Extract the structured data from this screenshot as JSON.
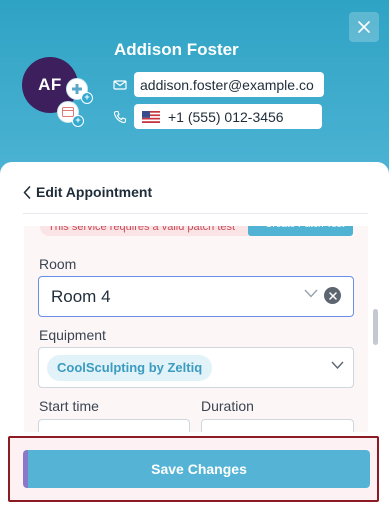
{
  "contact": {
    "initials": "AF",
    "name": "Addison Foster",
    "email": "addison.foster@example.co",
    "phone": "+1 (555) 012-3456"
  },
  "panel": {
    "title": "Edit Appointment",
    "warning_text": "This service requires a valid patch test",
    "patch_button": "+ Create Patch Test",
    "room": {
      "label": "Room",
      "value": "Room 4"
    },
    "equipment": {
      "label": "Equipment",
      "selected": "CoolSculpting by Zeltiq"
    },
    "start_time": {
      "label": "Start time"
    },
    "duration": {
      "label": "Duration"
    }
  },
  "footer": {
    "save_label": "Save Changes"
  },
  "colors": {
    "header": "#3fadcf",
    "avatar": "#3d1f5e",
    "accent": "#55b4d6",
    "focus_border": "#6a8fe8",
    "footer_border": "#8b1a23"
  },
  "icons": [
    "close-icon",
    "mail-icon",
    "phone-icon",
    "us-flag-icon",
    "chevron-left-icon",
    "chevron-down-icon",
    "clear-icon",
    "medical-plus-icon",
    "calendar-card-icon"
  ]
}
